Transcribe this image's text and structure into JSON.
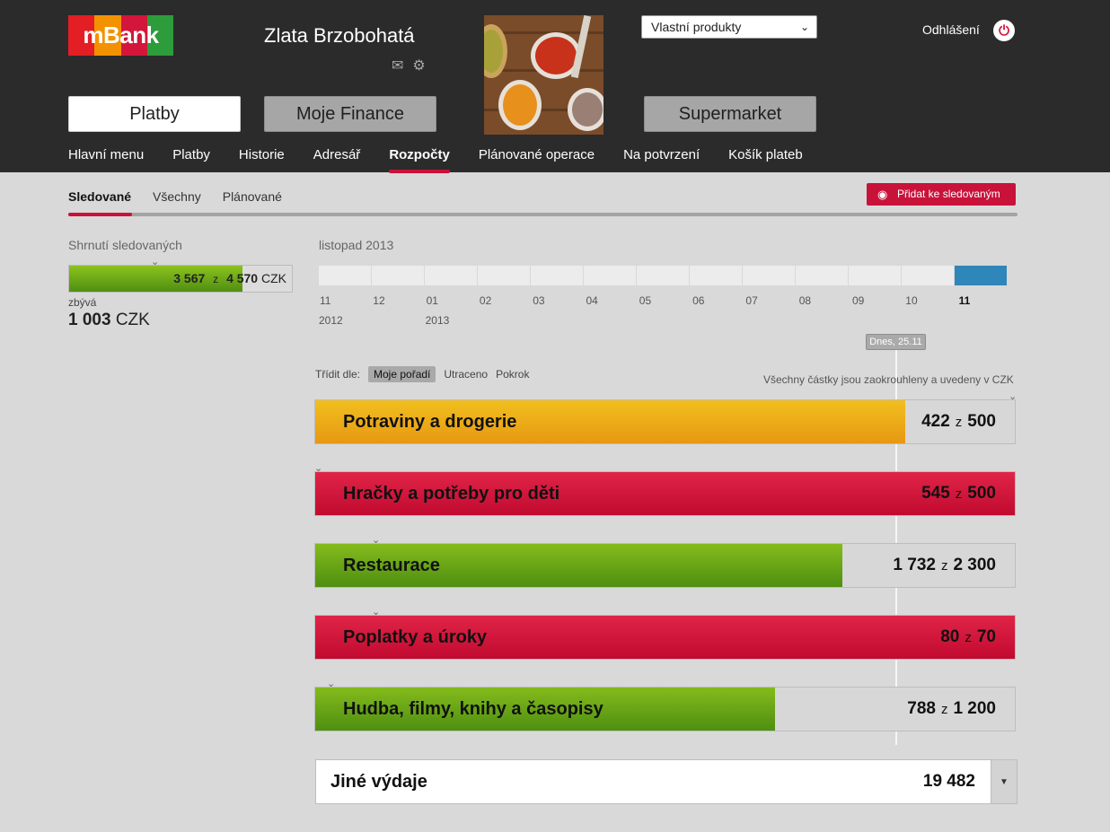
{
  "header": {
    "logo_text": "mBank",
    "logo_colors": [
      "#e31e24",
      "#f39200",
      "#e31e24",
      "#2d9c3b"
    ],
    "user_name": "Zlata Brzobohatá",
    "icons": [
      "mail-icon",
      "gear-icon"
    ],
    "product_select": "Vlastní produkty",
    "logout_label": "Odhlášení",
    "big_buttons": [
      "Platby",
      "Moje Finance",
      "Supermarket"
    ],
    "nav": [
      "Hlavní menu",
      "Platby",
      "Historie",
      "Adresář",
      "Rozpočty",
      "Plánované operace",
      "Na potvrzení",
      "Košík plateb"
    ],
    "active_nav": "Rozpočty"
  },
  "subtabs": {
    "items": [
      "Sledované",
      "Všechny",
      "Plánované"
    ],
    "active": "Sledované",
    "add_button": "Přidat ke sledovaným"
  },
  "summary": {
    "label": "Shrnutí sledovaných",
    "spent": "3 567",
    "sep": "z",
    "total": "4 570",
    "currency": "CZK",
    "fraction": 0.78,
    "remain_label": "zbývá",
    "remain_value": "1 003",
    "remain_currency": "CZK"
  },
  "timeline": {
    "month_title": "listopad 2013",
    "months": [
      "11",
      "12",
      "01",
      "02",
      "03",
      "04",
      "05",
      "06",
      "07",
      "08",
      "09",
      "10",
      "11"
    ],
    "years": [
      "2012",
      "2013"
    ],
    "current_index": 12,
    "today_label": "Dnes, 25.11"
  },
  "sort": {
    "label": "Třídit dle:",
    "options": [
      "Moje pořadí",
      "Utraceno",
      "Pokrok"
    ],
    "selected": "Moje pořadí",
    "note": "Všechny částky jsou zaokrouhleny a uvedeny v CZK"
  },
  "budgets": [
    {
      "name": "Potraviny a drogerie",
      "spent": "422",
      "sep": "z",
      "limit": "500",
      "fraction": 0.844,
      "color": "yellow"
    },
    {
      "name": "Hračky a potřeby pro děti",
      "spent": "545",
      "sep": "z",
      "limit": "500",
      "fraction": 1.0,
      "color": "red"
    },
    {
      "name": "Restaurace",
      "spent": "1 732",
      "sep": "z",
      "limit": "2 300",
      "fraction": 0.753,
      "color": "green"
    },
    {
      "name": "Poplatky a úroky",
      "spent": "80",
      "sep": "z",
      "limit": "70",
      "fraction": 1.0,
      "color": "red"
    },
    {
      "name": "Hudba, filmy, knihy a časopisy",
      "spent": "788",
      "sep": "z",
      "limit": "1 200",
      "fraction": 0.657,
      "color": "green"
    }
  ],
  "other": {
    "name": "Jiné výdaje",
    "amount": "19 482"
  }
}
